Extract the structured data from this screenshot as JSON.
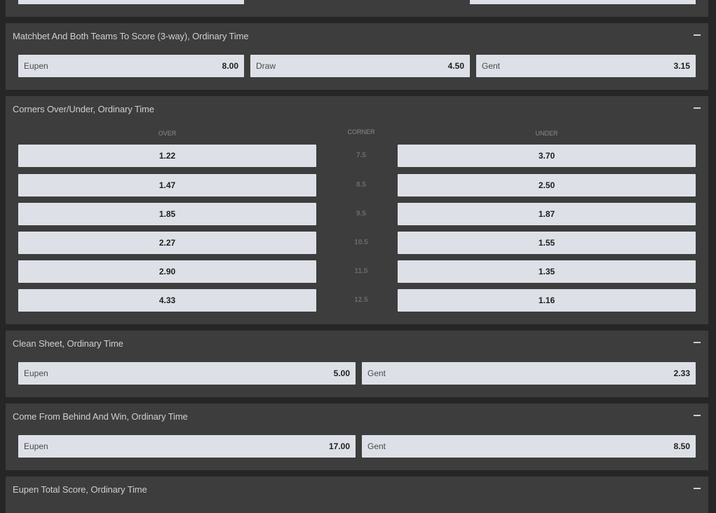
{
  "matchbet_btts": {
    "title": "Matchbet And Both Teams To Score (3-way), Ordinary Time",
    "options": [
      {
        "label": "Eupen",
        "odds": "8.00"
      },
      {
        "label": "Draw",
        "odds": "4.50"
      },
      {
        "label": "Gent",
        "odds": "3.15"
      }
    ]
  },
  "corners": {
    "title": "Corners Over/Under, Ordinary Time",
    "headers": {
      "over": "OVER",
      "corner": "CORNER",
      "under": "UNDER"
    },
    "rows": [
      {
        "over": "1.22",
        "line": "7.5",
        "under": "3.70"
      },
      {
        "over": "1.47",
        "line": "8.5",
        "under": "2.50"
      },
      {
        "over": "1.85",
        "line": "9.5",
        "under": "1.87"
      },
      {
        "over": "2.27",
        "line": "10.5",
        "under": "1.55"
      },
      {
        "over": "2.90",
        "line": "11.5",
        "under": "1.35"
      },
      {
        "over": "4.33",
        "line": "12.5",
        "under": "1.16"
      }
    ]
  },
  "clean_sheet": {
    "title": "Clean Sheet, Ordinary Time",
    "options": [
      {
        "label": "Eupen",
        "odds": "5.00"
      },
      {
        "label": "Gent",
        "odds": "2.33"
      }
    ]
  },
  "come_from_behind": {
    "title": "Come From Behind And Win, Ordinary Time",
    "options": [
      {
        "label": "Eupen",
        "odds": "17.00"
      },
      {
        "label": "Gent",
        "odds": "8.50"
      }
    ]
  },
  "eupen_total": {
    "title": "Eupen Total Score, Ordinary Time"
  },
  "colors": {
    "page_bg": "#262626",
    "panel_bg": "#3d3d3d",
    "button_bg": "#dde1e7"
  }
}
